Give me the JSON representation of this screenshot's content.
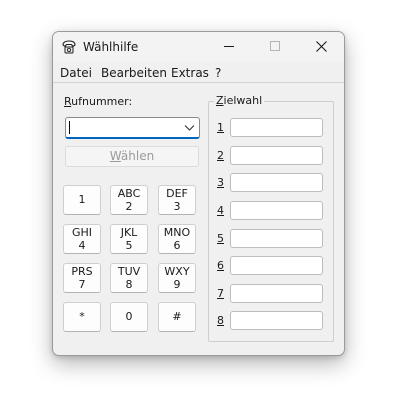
{
  "window": {
    "title": "Wählhilfe"
  },
  "menu": [
    "Datei",
    "Bearbeiten",
    "Extras",
    "?"
  ],
  "phone_number": {
    "label_mnemonic": "R",
    "label_rest": "ufnummer:",
    "value": ""
  },
  "dial_button": {
    "mnemonic": "W",
    "rest": "ählen"
  },
  "keypad": [
    {
      "top": "",
      "bottom": "1"
    },
    {
      "top": "ABC",
      "bottom": "2"
    },
    {
      "top": "DEF",
      "bottom": "3"
    },
    {
      "top": "GHI",
      "bottom": "4"
    },
    {
      "top": "JKL",
      "bottom": "5"
    },
    {
      "top": "MNO",
      "bottom": "6"
    },
    {
      "top": "PRS",
      "bottom": "7"
    },
    {
      "top": "TUV",
      "bottom": "8"
    },
    {
      "top": "WXY",
      "bottom": "9"
    },
    {
      "top": "",
      "bottom": "*"
    },
    {
      "top": "",
      "bottom": "0"
    },
    {
      "top": "",
      "bottom": "#"
    }
  ],
  "speed_dial": {
    "title_mnemonic": "Z",
    "title_rest": "ielwahl",
    "entries": [
      {
        "number": "1",
        "value": ""
      },
      {
        "number": "2",
        "value": ""
      },
      {
        "number": "3",
        "value": ""
      },
      {
        "number": "4",
        "value": ""
      },
      {
        "number": "5",
        "value": ""
      },
      {
        "number": "6",
        "value": ""
      },
      {
        "number": "7",
        "value": ""
      },
      {
        "number": "8",
        "value": ""
      }
    ]
  },
  "colors": {
    "accent": "#0067c0",
    "window_bg": "#f0f0f0",
    "disabled_text": "#9a9a9a"
  },
  "icons": [
    "phone-app-icon",
    "minimize-icon",
    "maximize-icon",
    "close-icon",
    "chevron-down-icon"
  ]
}
